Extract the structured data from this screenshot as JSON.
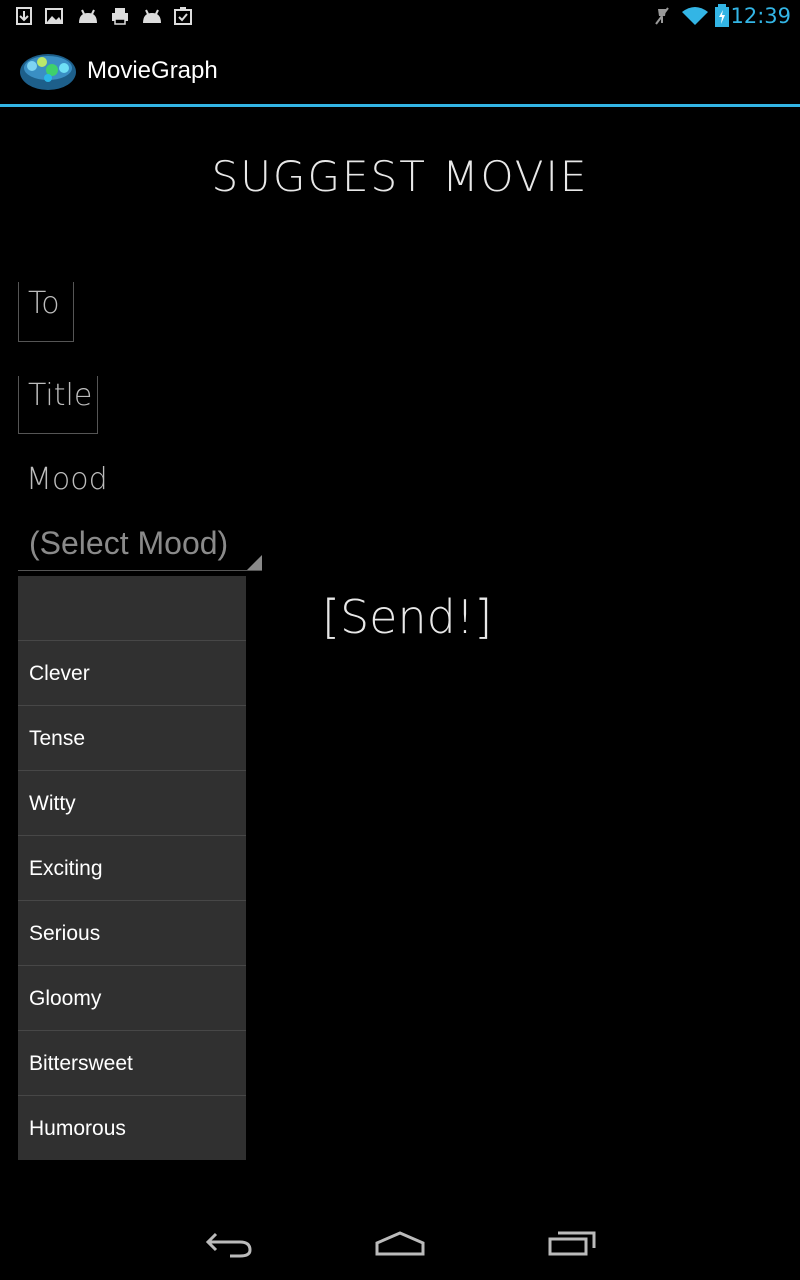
{
  "status_bar": {
    "time": "12:39",
    "left_icons": [
      "download-icon",
      "image-icon",
      "android-icon",
      "printer-icon",
      "android-icon",
      "checklist-icon"
    ],
    "right_icons": [
      "mute-icon",
      "wifi-icon",
      "battery-charging-icon"
    ],
    "accent_color": "#33b5e5"
  },
  "action_bar": {
    "title": "MovieGraph",
    "divider_color": "#33b5e5"
  },
  "form": {
    "heading": "SUGGEST MOVIE",
    "to_label": "To",
    "title_label": "Title",
    "mood_label": "Mood",
    "mood_select_value": "(Select Mood)",
    "send_label": "[Send!]"
  },
  "dropdown": {
    "options": [
      "",
      "Clever",
      "Tense",
      "Witty",
      "Exciting",
      "Serious",
      "Gloomy",
      "Bittersweet",
      "Humorous"
    ]
  },
  "nav_bar": {
    "icons": [
      "back-icon",
      "home-icon",
      "recent-apps-icon"
    ]
  }
}
